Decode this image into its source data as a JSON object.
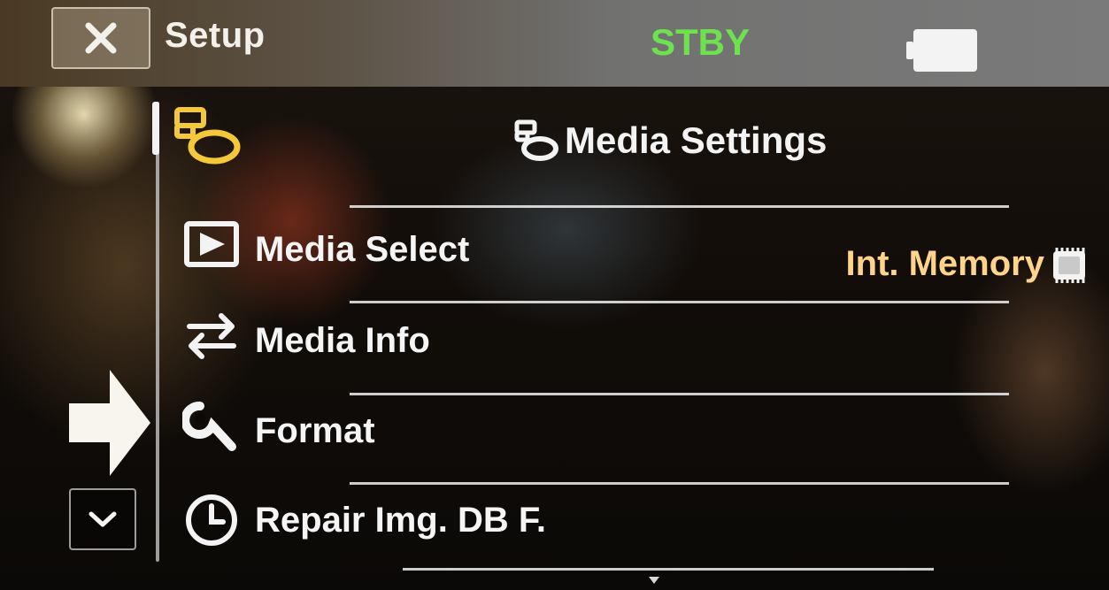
{
  "header": {
    "close_icon": "close-icon",
    "title": "Setup",
    "status": "STBY",
    "battery_icon": "battery-icon",
    "status_color": "#6ee24e"
  },
  "category": {
    "icon": "media-settings-icon",
    "title": "Media Settings",
    "accent_color": "#f5c83a"
  },
  "menu": {
    "items": [
      {
        "label": "Media Select",
        "icon": "play-screen-icon",
        "value": "Int. Memory",
        "value_icon": "memory-chip-icon"
      },
      {
        "label": "Media Info",
        "icon": "transfer-arrows-icon"
      },
      {
        "label": "Format",
        "icon": "wrench-icon"
      },
      {
        "label": "Repair Img. DB F.",
        "icon": "clock-repair-icon"
      }
    ],
    "selected_label": "Format",
    "value_color": "#ffd48a"
  },
  "navigation": {
    "pointer_icon": "arrow-right-icon",
    "scroll_down_icon": "chevron-down-icon"
  }
}
